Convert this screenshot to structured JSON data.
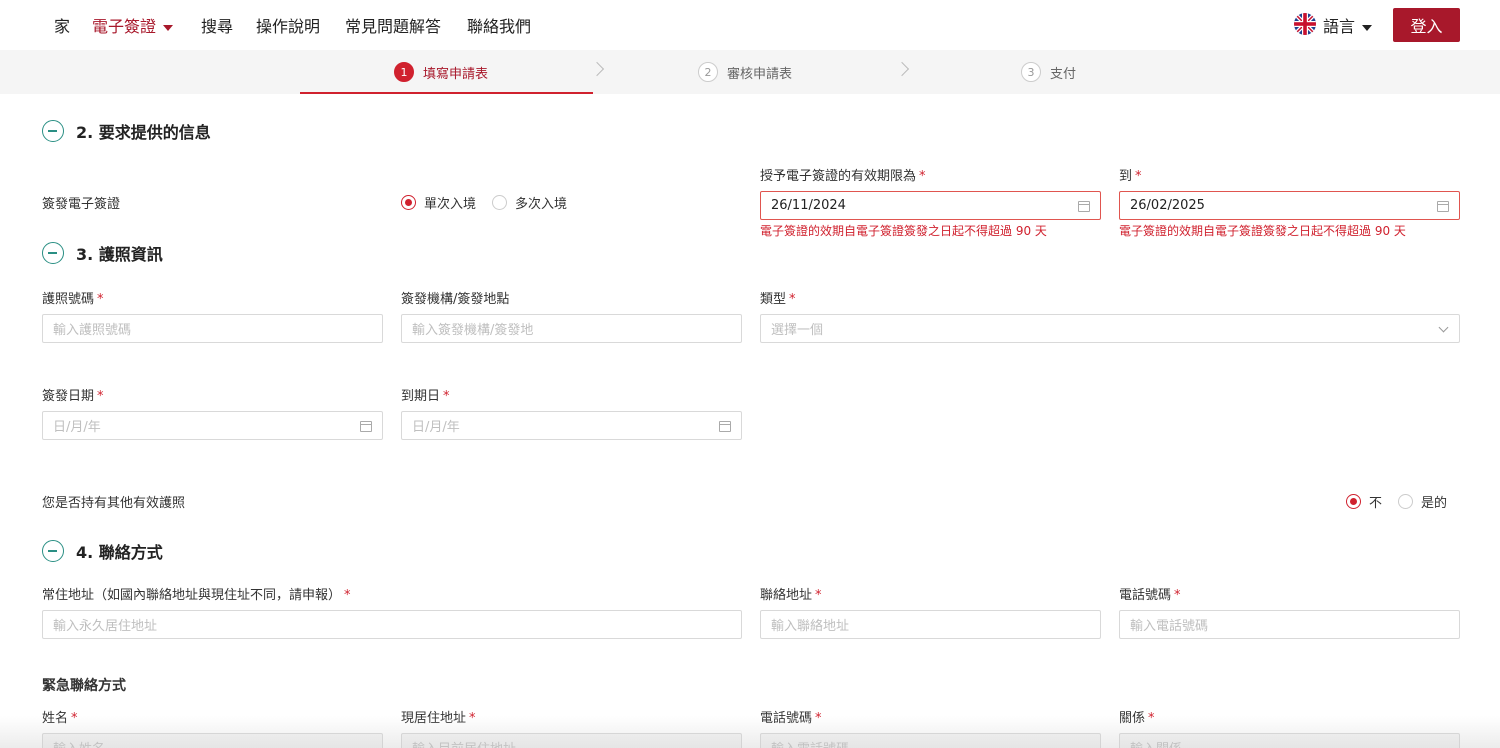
{
  "nav": {
    "items": [
      "家",
      "電子簽證",
      "搜尋",
      "操作說明",
      "常見問題解答",
      "聯絡我們"
    ],
    "language_label": "語言",
    "login_label": "登入"
  },
  "steps": [
    {
      "num": "1",
      "label": "填寫申請表"
    },
    {
      "num": "2",
      "label": "審核申請表"
    },
    {
      "num": "3",
      "label": "支付"
    }
  ],
  "section2": {
    "title": "2. 要求提供的信息",
    "visa_type_label": "簽發電子簽證",
    "visa_options": [
      "單次入境",
      "多次入境"
    ],
    "validity_label": "授予電子簽證的有效期限為",
    "to_label": "到",
    "from_date": "26/11/2024",
    "to_date": "26/02/2025",
    "error_msg": "電子簽證的效期自電子簽證簽發之日起不得超過 90 天"
  },
  "section3": {
    "title": "3. 護照資訊",
    "passport_no_label": "護照號碼",
    "passport_no_placeholder": "輸入護照號碼",
    "issuer_label": "簽發機構/簽發地點",
    "issuer_placeholder": "輸入簽發機構/簽發地",
    "type_label": "類型",
    "type_placeholder": "選擇一個",
    "issue_date_label": "簽發日期",
    "issue_date_placeholder": "日/月/年",
    "expiry_label": "到期日",
    "expiry_placeholder": "日/月/年",
    "other_passport_label": "您是否持有其他有效護照",
    "other_passport_options": [
      "不",
      "是的"
    ]
  },
  "section4": {
    "title": "4. 聯絡方式",
    "address_label": "常住地址（如國內聯絡地址與現住址不同，請申報）",
    "address_placeholder": "輸入永久居住地址",
    "contact_address_label": "聯絡地址",
    "contact_address_placeholder": "輸入聯絡地址",
    "phone_label": "電話號碼",
    "phone_placeholder": "輸入電話號碼",
    "emergency_title": "緊急聯絡方式",
    "name_label": "姓名",
    "name_placeholder": "輸入姓名",
    "current_address_label": "現居住地址",
    "current_address_placeholder": "輸入目前居住地址",
    "emergency_phone_label": "電話號碼",
    "emergency_phone_placeholder": "輸入電話號碼",
    "relation_label": "關係",
    "relation_placeholder": "輸入關係"
  },
  "colors": {
    "brand": "#a8182b",
    "accent": "#2a8f84",
    "error": "#d0212e"
  }
}
